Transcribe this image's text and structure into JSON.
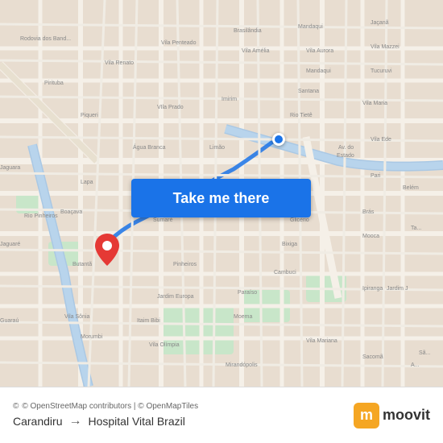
{
  "map": {
    "background_color": "#e8e0d8",
    "button_label": "Take me there",
    "button_color": "#1a73e8"
  },
  "footer": {
    "attribution": "© OpenStreetMap contributors | © OpenMapTiles",
    "origin": "Carandiru",
    "destination": "Hospital Vital Brazil",
    "arrow": "→",
    "moovit_letter": "m",
    "moovit_name": "moovit"
  }
}
